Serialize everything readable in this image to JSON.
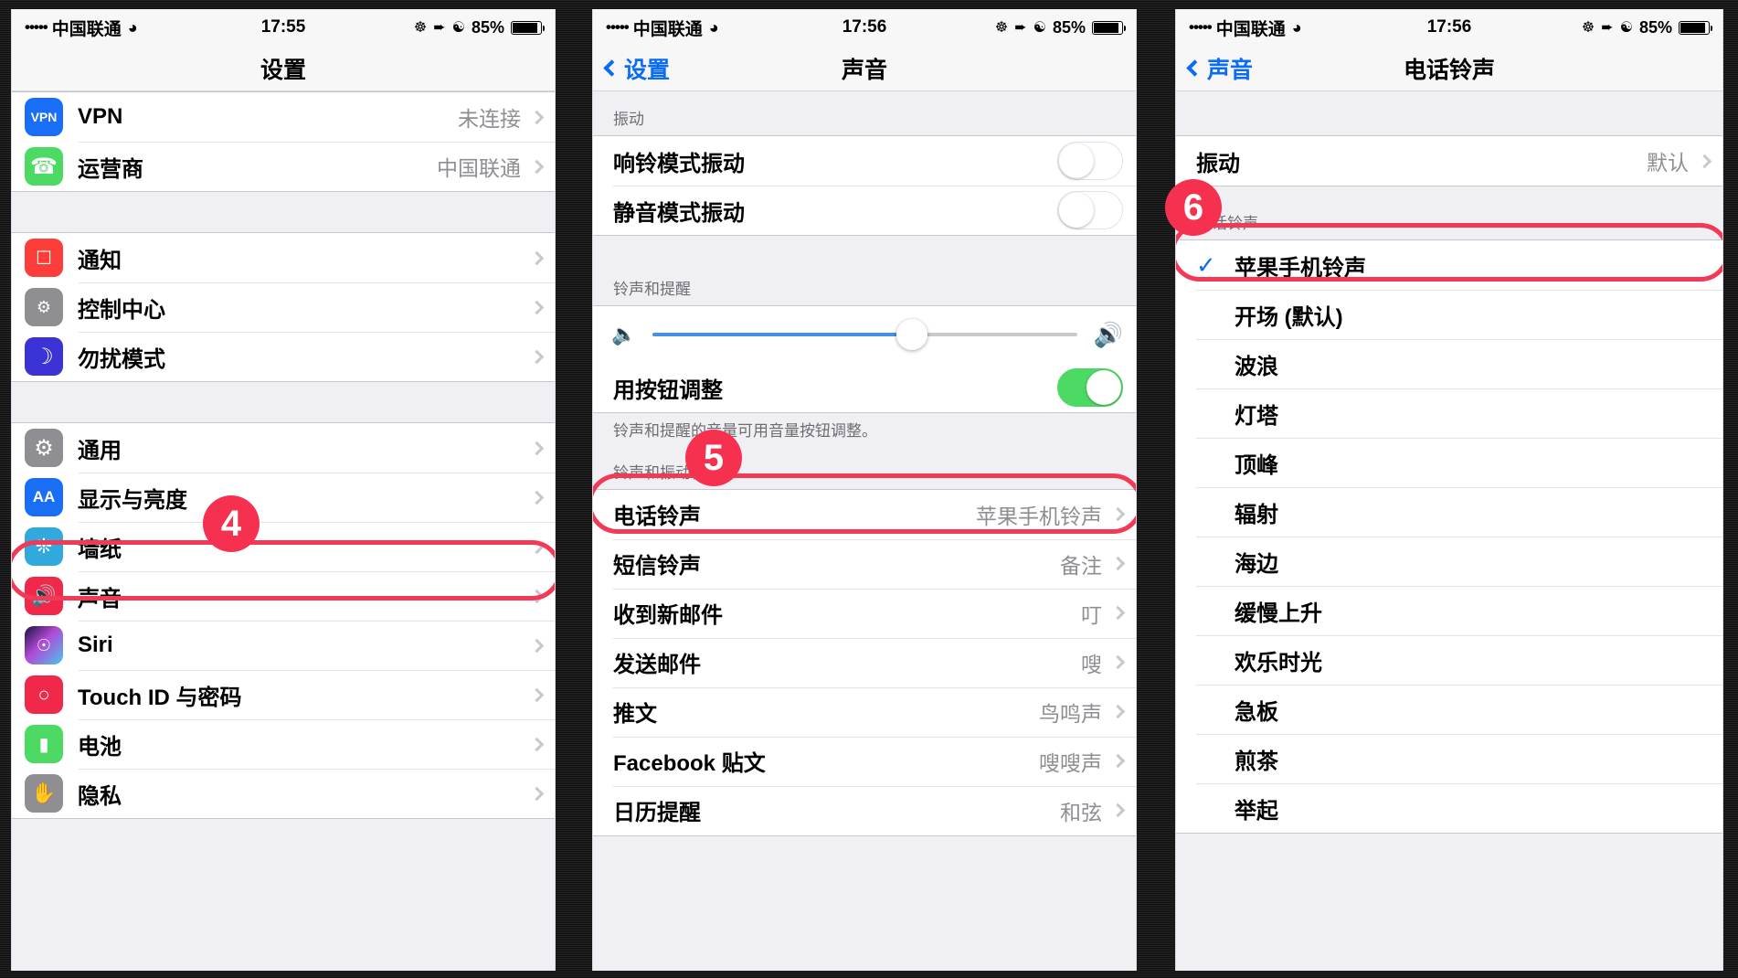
{
  "panels": [
    {
      "id": "settings",
      "status": {
        "dots": "•••••",
        "carrier": "中国联通",
        "wifi_icon": "wifi-icon",
        "time": "17:55",
        "icons": [
          "alarm-icon",
          "location-icon",
          "do-not-disturb-icon"
        ],
        "battery_pct": "85%"
      },
      "nav": {
        "back": "",
        "title": "设置"
      },
      "sections": [
        {
          "header": "",
          "rows": [
            {
              "icon": "vpn-icon",
              "label": "VPN",
              "value": "未连接",
              "chevron": true
            },
            {
              "icon": "phone-icon",
              "label": "运营商",
              "value": "中国联通",
              "chevron": true
            }
          ]
        },
        {
          "header": "",
          "rows": [
            {
              "icon": "notifications-icon",
              "label": "通知",
              "value": "",
              "chevron": true
            },
            {
              "icon": "control-center-icon",
              "label": "控制中心",
              "value": "",
              "chevron": true
            },
            {
              "icon": "moon-icon",
              "label": "勿扰模式",
              "value": "",
              "chevron": true
            }
          ]
        },
        {
          "header": "",
          "rows": [
            {
              "icon": "gear-icon",
              "label": "通用",
              "value": "",
              "chevron": true
            },
            {
              "icon": "display-icon",
              "label": "显示与亮度",
              "value": "",
              "chevron": true
            },
            {
              "icon": "wallpaper-icon",
              "label": "墙纸",
              "value": "",
              "chevron": true
            },
            {
              "icon": "sounds-icon",
              "label": "声音",
              "value": "",
              "chevron": true,
              "highlight": true
            },
            {
              "icon": "siri-icon",
              "label": "Siri",
              "value": "",
              "chevron": true
            },
            {
              "icon": "touchid-icon",
              "label": "Touch ID 与密码",
              "value": "",
              "chevron": true
            },
            {
              "icon": "battery-icon",
              "label": "电池",
              "value": "",
              "chevron": true
            },
            {
              "icon": "privacy-icon",
              "label": "隐私",
              "value": "",
              "chevron": true
            }
          ]
        }
      ],
      "annotation": {
        "number": "4"
      }
    },
    {
      "id": "sounds",
      "status": {
        "dots": "•••••",
        "carrier": "中国联通",
        "wifi_icon": "wifi-icon",
        "time": "17:56",
        "icons": [
          "alarm-icon",
          "location-icon",
          "do-not-disturb-icon"
        ],
        "battery_pct": "85%"
      },
      "nav": {
        "back": "设置",
        "title": "声音"
      },
      "vibrate_header": "振动",
      "vibrate_rows": [
        {
          "label": "响铃模式振动",
          "on": false
        },
        {
          "label": "静音模式振动",
          "on": false
        }
      ],
      "ringer_header": "铃声和提醒",
      "volume_slider": {
        "value": 61,
        "left_icon": "speaker-mute-icon",
        "right_icon": "speaker-loud-icon"
      },
      "button_row": {
        "label": "用按钮调整",
        "on": true
      },
      "ringer_footer": "铃声和提醒的音量可用音量按钮调整。",
      "pattern_header": "铃声和振动模式",
      "pattern_rows": [
        {
          "label": "电话铃声",
          "value": "苹果手机铃声",
          "highlight": true
        },
        {
          "label": "短信铃声",
          "value": "备注"
        },
        {
          "label": "收到新邮件",
          "value": "叮"
        },
        {
          "label": "发送邮件",
          "value": "嗖"
        },
        {
          "label": "推文",
          "value": "鸟鸣声"
        },
        {
          "label": "Facebook 贴文",
          "value": "嗖嗖声"
        },
        {
          "label": "日历提醒",
          "value": "和弦"
        }
      ],
      "annotation": {
        "number": "5"
      }
    },
    {
      "id": "ringtone",
      "status": {
        "dots": "•••••",
        "carrier": "中国联通",
        "wifi_icon": "wifi-icon",
        "time": "17:56",
        "icons": [
          "alarm-icon",
          "location-icon",
          "do-not-disturb-icon"
        ],
        "battery_pct": "85%"
      },
      "nav": {
        "back": "声音",
        "title": "电话铃声"
      },
      "vibrate_row": {
        "label": "振动",
        "value": "默认"
      },
      "list_header": "电话铃声",
      "ringtones": [
        {
          "label": "苹果手机铃声",
          "selected": true,
          "highlight": true
        },
        {
          "label": "开场 (默认)",
          "selected": false
        },
        {
          "label": "波浪",
          "selected": false
        },
        {
          "label": "灯塔",
          "selected": false
        },
        {
          "label": "顶峰",
          "selected": false
        },
        {
          "label": "辐射",
          "selected": false
        },
        {
          "label": "海边",
          "selected": false
        },
        {
          "label": "缓慢上升",
          "selected": false
        },
        {
          "label": "欢乐时光",
          "selected": false
        },
        {
          "label": "急板",
          "selected": false
        },
        {
          "label": "煎茶",
          "selected": false
        },
        {
          "label": "举起",
          "selected": false
        }
      ],
      "annotation": {
        "number": "6"
      }
    }
  ],
  "colors": {
    "accent_blue": "#0a6cf5",
    "annotation_red": "#f5314f",
    "toggle_green": "#4cd964",
    "slider_blue": "#4a90e2"
  }
}
